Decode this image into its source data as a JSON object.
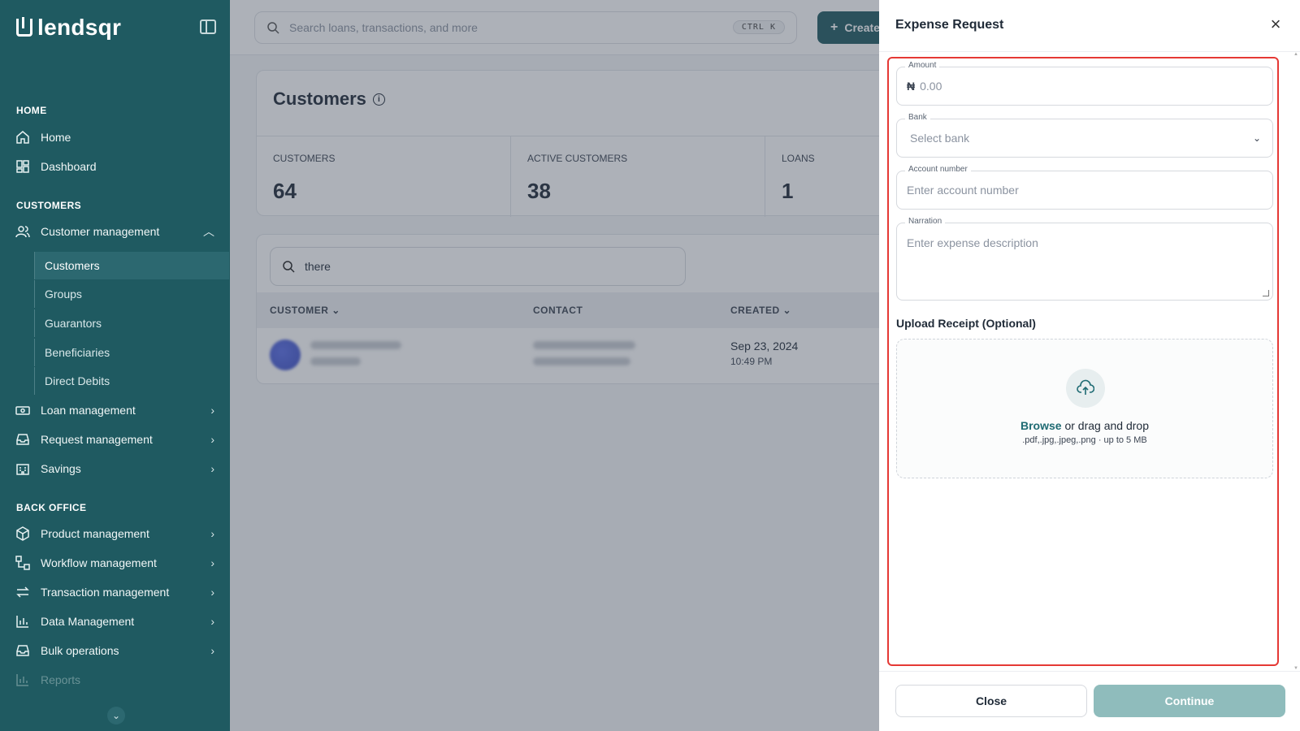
{
  "brand": {
    "name": "lendsqr"
  },
  "sidebar": {
    "sections": {
      "home": "HOME",
      "customers": "CUSTOMERS",
      "back_office": "BACK OFFICE"
    },
    "home_items": [
      {
        "label": "Home",
        "icon": "home-icon"
      },
      {
        "label": "Dashboard",
        "icon": "dashboard-icon"
      }
    ],
    "customer_management": {
      "label": "Customer management",
      "icon": "users-icon",
      "expanded": true
    },
    "customer_sub_items": [
      {
        "label": "Customers",
        "active": true
      },
      {
        "label": "Groups"
      },
      {
        "label": "Guarantors"
      },
      {
        "label": "Beneficiaries"
      },
      {
        "label": "Direct Debits"
      }
    ],
    "more_items": [
      {
        "label": "Loan management",
        "icon": "loan-icon"
      },
      {
        "label": "Request management",
        "icon": "inbox-icon"
      },
      {
        "label": "Savings",
        "icon": "savings-icon"
      }
    ],
    "back_office_items": [
      {
        "label": "Product management",
        "icon": "box-icon"
      },
      {
        "label": "Workflow management",
        "icon": "workflow-icon"
      },
      {
        "label": "Transaction management",
        "icon": "transfer-icon"
      },
      {
        "label": "Data Management",
        "icon": "chart-icon"
      },
      {
        "label": "Bulk operations",
        "icon": "bulk-icon"
      },
      {
        "label": "Reports",
        "icon": "reports-icon"
      }
    ]
  },
  "topbar": {
    "search_placeholder": "Search loans, transactions, and more",
    "shortcut": "CTRL  K",
    "create_label": "Create"
  },
  "customers": {
    "title": "Customers",
    "stats": [
      {
        "label": "CUSTOMERS",
        "value": "64"
      },
      {
        "label": "ACTIVE CUSTOMERS",
        "value": "38"
      },
      {
        "label": "LOANS",
        "value": "1"
      }
    ],
    "filter_value": "there",
    "columns": [
      "CUSTOMER",
      "CONTACT",
      "CREATED"
    ],
    "rows": [
      {
        "created_date": "Sep 23, 2024",
        "created_time": "10:49 PM"
      }
    ]
  },
  "drawer": {
    "title": "Expense Request",
    "amount": {
      "label": "Amount",
      "currency": "₦",
      "placeholder": "0.00"
    },
    "bank": {
      "label": "Bank",
      "placeholder": "Select bank"
    },
    "account_number": {
      "label": "Account number",
      "placeholder": "Enter account number"
    },
    "narration": {
      "label": "Narration",
      "placeholder": "Enter expense description"
    },
    "upload": {
      "title": "Upload Receipt (Optional)",
      "browse": "Browse",
      "rest": " or drag and drop",
      "hint": ".pdf,.jpg,.jpeg,.png · up to 5 MB"
    },
    "close_label": "Close",
    "continue_label": "Continue"
  },
  "colors": {
    "sidebar_bg": "#1f5a61",
    "accent": "#1f6b73",
    "continue_disabled": "#8fbcbc",
    "highlight": "#e53935"
  }
}
